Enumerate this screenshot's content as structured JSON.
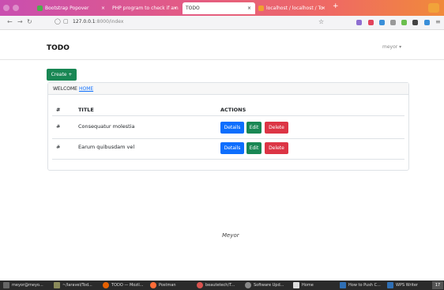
{
  "browser": {
    "tabs": [
      {
        "label": "Bootstrap Popover",
        "close": "×",
        "color": "#4cae4c"
      },
      {
        "label": "PHP program to check if a n",
        "close": "×",
        "color": "#e25a86"
      },
      {
        "label": "TODO",
        "close": "×",
        "color": "#ffffff"
      },
      {
        "label": "localhost / localhost / To",
        "close": "×",
        "color": "#f0a030"
      }
    ],
    "new_tab": "+",
    "url_host": "127.0.0.1",
    "url_rest": ":8000/index"
  },
  "app": {
    "brand": "TODO",
    "user": "meyor",
    "user_caret": "▾",
    "create_button": "Create +",
    "welcome_text": "WELCOME",
    "welcome_link": "HOME",
    "table": {
      "headers": [
        "#",
        "TITLE",
        "ACTIONS"
      ],
      "rows": [
        {
          "num": "#",
          "title": "Consequatur molestia"
        },
        {
          "num": "#",
          "title": "Earum quibusdam vel"
        }
      ],
      "actions": {
        "details": "Details",
        "edit": "Edit",
        "delete": "Delete"
      }
    },
    "footer": "Meyor"
  },
  "taskbar": {
    "items": [
      {
        "label": "meyor@meyo...",
        "color": "#666666"
      },
      {
        "label": "~/laravel/Tod...",
        "color": "#8a8a5a"
      },
      {
        "label": "TODO — Mozil...",
        "color": "#e66000"
      },
      {
        "label": "Postman",
        "color": "#ff6c37"
      },
      {
        "label": "beautetech/T...",
        "color": "#d9534f"
      },
      {
        "label": "Software Upd...",
        "color": "#888888"
      },
      {
        "label": "Home",
        "color": "#dddddd"
      },
      {
        "label": "How to Push C...",
        "color": "#2f6fb5"
      },
      {
        "label": "WPS Writer",
        "color": "#2f6fb5"
      }
    ],
    "clock": "17"
  },
  "colors": {
    "primary": "#0d6efd",
    "success": "#198754",
    "danger": "#dc3545"
  }
}
